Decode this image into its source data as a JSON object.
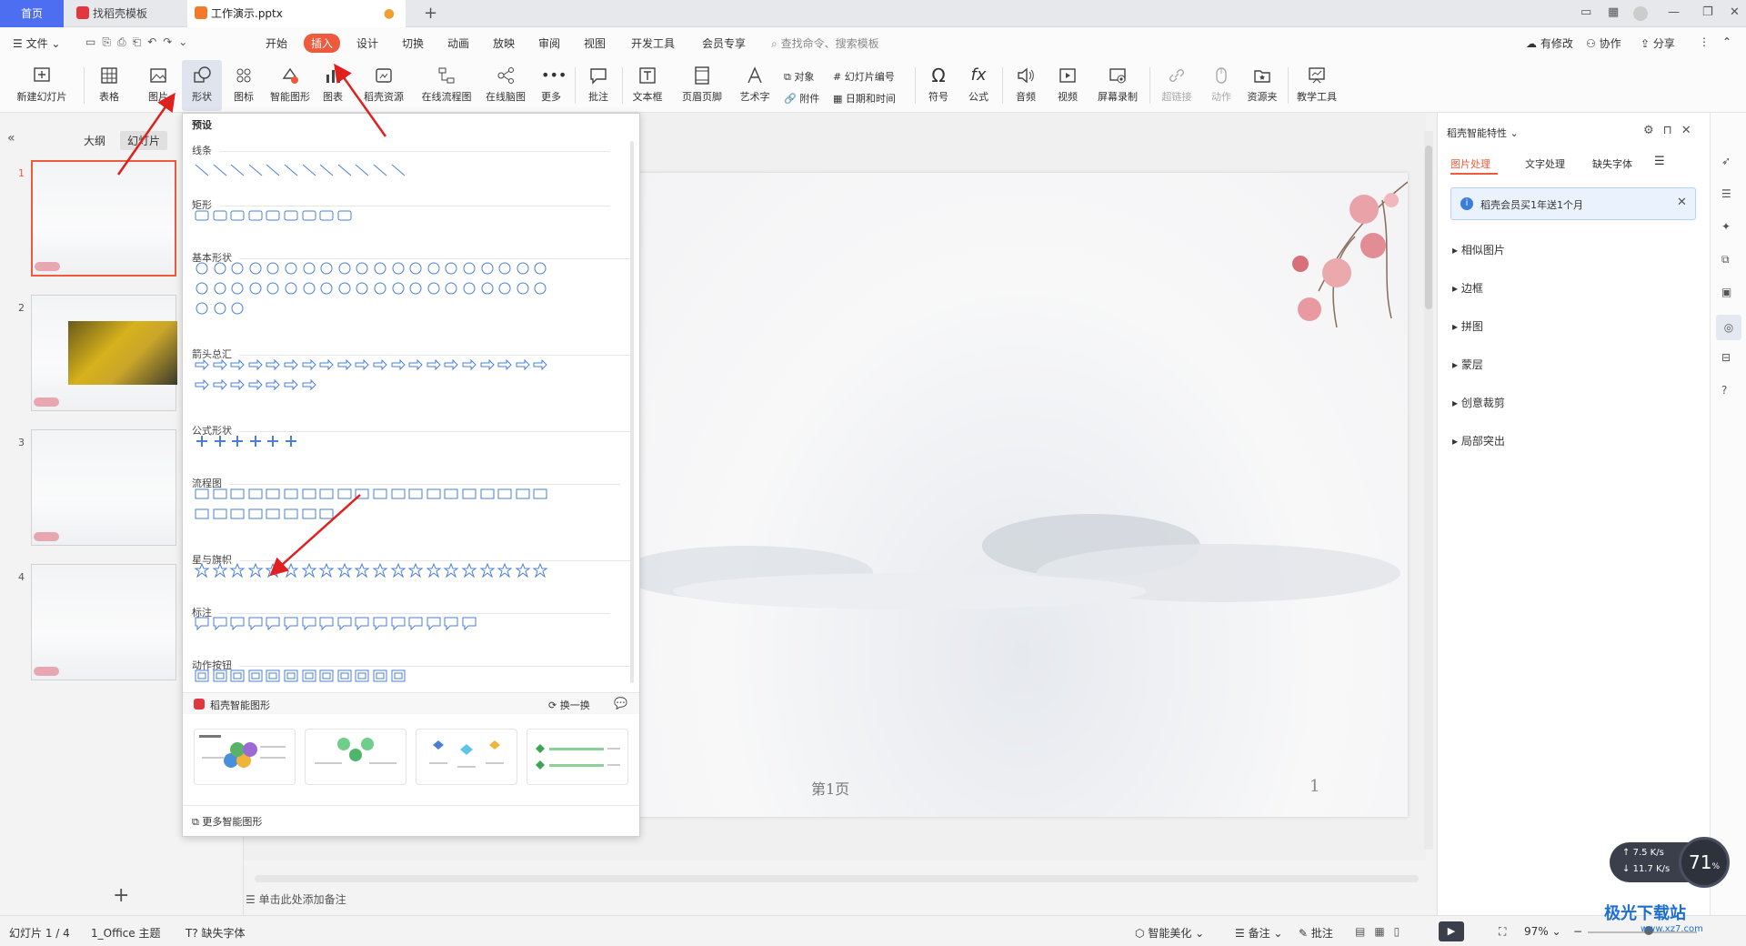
{
  "tabs": {
    "home": "首页",
    "template": "找稻壳模板",
    "document": "工作演示.pptx",
    "new_tab": "+"
  },
  "menu": {
    "file": "文件",
    "items": [
      "开始",
      "插入",
      "设计",
      "切换",
      "动画",
      "放映",
      "审阅",
      "视图",
      "开发工具",
      "会员专享"
    ],
    "search_placeholder": "查找命令、搜索模板",
    "right": [
      "有修改",
      "协作",
      "分享"
    ]
  },
  "ribbon": {
    "new_slide": "新建幻灯片",
    "table": "表格",
    "picture": "图片",
    "shape": "形状",
    "icon": "图标",
    "smart_shape": "智能图形",
    "chart": "图表",
    "docer_resource": "稻壳资源",
    "flowchart": "在线流程图",
    "mindmap": "在线脑图",
    "more": "更多",
    "comment": "批注",
    "textbox": "文本框",
    "header_footer": "页眉页脚",
    "wordart": "艺术字",
    "object": "对象",
    "attachment": "附件",
    "slide_number": "幻灯片编号",
    "datetime": "日期和时间",
    "symbol": "符号",
    "formula": "公式",
    "audio": "音频",
    "video": "视频",
    "screen_record": "屏幕录制",
    "hyperlink": "超链接",
    "action": "动作",
    "resource_folder": "资源夹",
    "teaching_tool": "教学工具"
  },
  "left_panel": {
    "outline_tab": "大纲",
    "slides_tab": "幻灯片",
    "slide_numbers": [
      "1",
      "2",
      "3",
      "4"
    ],
    "add": "+"
  },
  "dropdown": {
    "preset": "预设",
    "sections": [
      "线条",
      "矩形",
      "基本形状",
      "箭头总汇",
      "公式形状",
      "流程图",
      "星与旗帜",
      "标注",
      "动作按钮"
    ],
    "smart_title": "稻壳智能图形",
    "refresh": "换一换",
    "more_smart": "更多智能图形"
  },
  "slide": {
    "page_label": "第1页",
    "page_number": "1"
  },
  "notes_placeholder": "单击此处添加备注",
  "right_panel": {
    "title": "稻壳智能特性",
    "tabs": [
      "图片处理",
      "文字处理",
      "缺失字体"
    ],
    "banner": "稻壳会员买1年送1个月",
    "items": [
      "相似图片",
      "边框",
      "拼图",
      "蒙层",
      "创意裁剪",
      "局部突出"
    ]
  },
  "status": {
    "slide_info": "幻灯片 1 / 4",
    "theme": "1_Office 主题",
    "missing_font": "缺失字体",
    "beautify": "智能美化",
    "notes": "备注",
    "comments": "批注",
    "zoom": "97%"
  },
  "net_widget": {
    "up": "7.5",
    "down": "11.7",
    "unit": "K/s",
    "percent": "71",
    "percent_unit": "%"
  },
  "watermark": {
    "name": "极光下载站",
    "url": "www.xz7.com"
  },
  "colors": {
    "accent": "#ef5a3d",
    "blue": "#4e6ef2",
    "shape_stroke": "#4a7fd4",
    "arrow": "#e02020"
  }
}
